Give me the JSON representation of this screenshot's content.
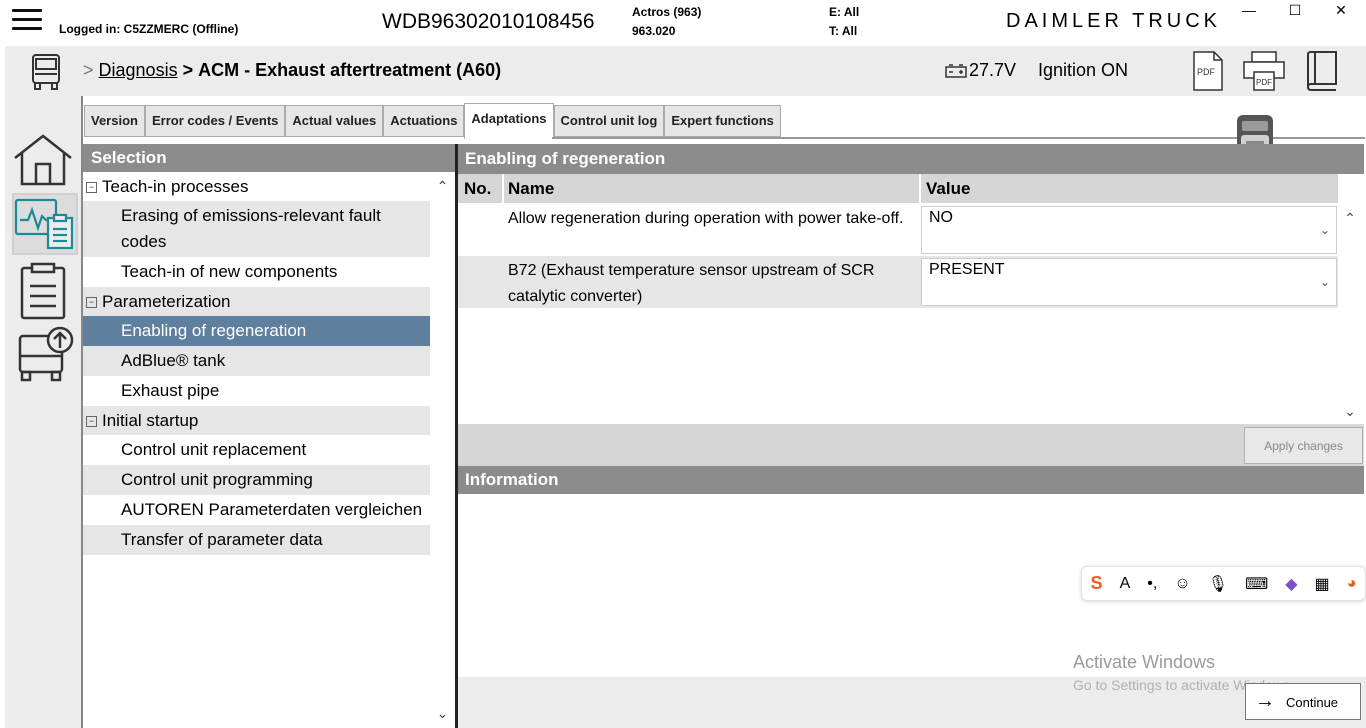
{
  "topbar": {
    "login_text": "Logged in: C5ZZMERC (Offline)",
    "vin": "WDB96302010108456",
    "model_name": "Actros (963)",
    "model_code": "963.020",
    "e_label": "E: All",
    "t_label": "T: All",
    "brand": "DAIMLER TRUCK",
    "window_controls": {
      "minimize": "—",
      "maximize": "☐",
      "close": "✕"
    }
  },
  "breadcrumb": {
    "sep1": ">",
    "diagnosis": "Diagnosis",
    "sep2": ">",
    "current": "ACM - Exhaust aftertreatment (A60)"
  },
  "status": {
    "voltage": "27.7V",
    "ignition": "Ignition ON"
  },
  "toolbar": {
    "pdf_label": "PDF",
    "print_pdf_label": "PDF"
  },
  "tabs": [
    {
      "label": "Version"
    },
    {
      "label": "Error codes / Events"
    },
    {
      "label": "Actual values"
    },
    {
      "label": "Actuations"
    },
    {
      "label": "Adaptations"
    },
    {
      "label": "Control unit log"
    },
    {
      "label": "Expert functions"
    }
  ],
  "selection": {
    "title": "Selection",
    "categories": [
      {
        "label": "Teach-in processes",
        "items": [
          "Erasing of emissions-relevant fault codes",
          "Teach-in of new components"
        ]
      },
      {
        "label": "Parameterization",
        "items": [
          "Enabling of regeneration",
          "AdBlue® tank",
          "Exhaust pipe"
        ]
      },
      {
        "label": "Initial startup",
        "items": [
          "Control unit replacement",
          "Control unit programming",
          "AUTOREN Parameterdaten vergleichen",
          "Transfer of parameter data"
        ]
      }
    ]
  },
  "regeneration": {
    "title": "Enabling of regeneration",
    "col_no": "No.",
    "col_name": "Name",
    "col_value": "Value",
    "rows": [
      {
        "name": "Allow regeneration during operation with power take-off.",
        "value": "NO"
      },
      {
        "name": "B72 (Exhaust temperature sensor upstream of SCR catalytic converter)",
        "value": "PRESENT"
      }
    ],
    "apply_label": "Apply changes"
  },
  "information": {
    "title": "Information"
  },
  "footer": {
    "continue_label": "Continue",
    "watermark_title": "Activate Windows",
    "watermark_sub": "Go to Settings to activate Windows."
  },
  "colors": {
    "header_grey": "#8c8c8c",
    "selected_blue": "#5f7f9f",
    "row_grey": "#e6e6e6",
    "teal_icon": "#1a8a94"
  }
}
